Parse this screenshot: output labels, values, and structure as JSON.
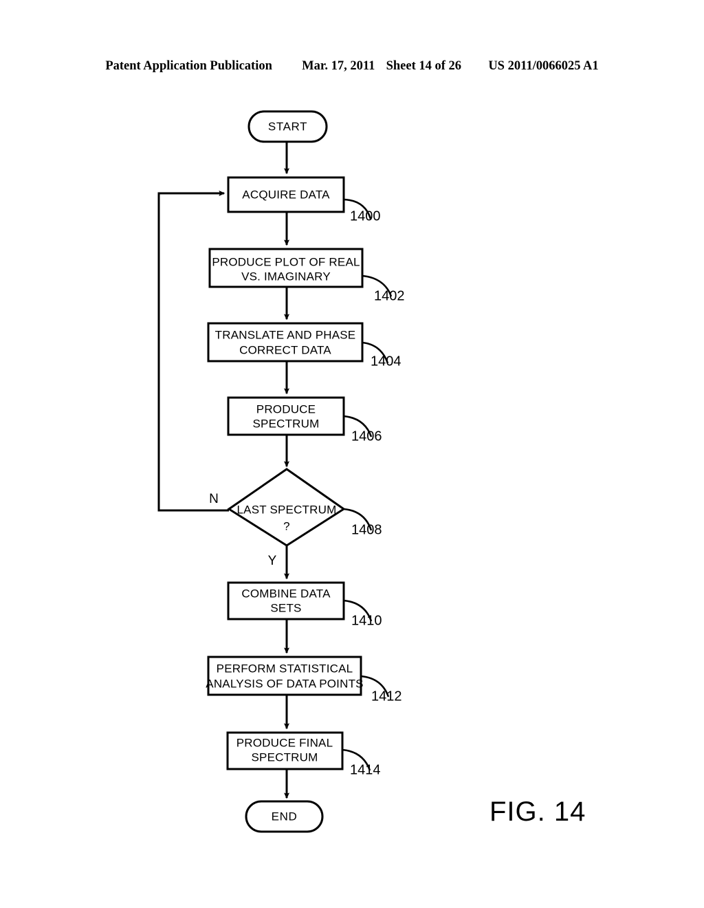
{
  "header": {
    "publication": "Patent Application Publication",
    "date": "Mar. 17, 2011",
    "sheet": "Sheet 14 of 26",
    "patent_number": "US 2011/0066025 A1"
  },
  "figure": {
    "label": "FIG. 14"
  },
  "flowchart": {
    "start_label": "START",
    "end_label": "END",
    "branch_no": "N",
    "branch_yes": "Y",
    "nodes": [
      {
        "id": "acquire-data",
        "shape": "process",
        "ref": "1400",
        "lines": [
          "ACQUIRE DATA"
        ]
      },
      {
        "id": "produce-plot",
        "shape": "process",
        "ref": "1402",
        "lines": [
          "PRODUCE PLOT OF REAL",
          "VS. IMAGINARY"
        ]
      },
      {
        "id": "translate-phase-correct",
        "shape": "process",
        "ref": "1404",
        "lines": [
          "TRANSLATE AND PHASE",
          "CORRECT DATA"
        ]
      },
      {
        "id": "produce-spectrum",
        "shape": "process",
        "ref": "1406",
        "lines": [
          "PRODUCE",
          "SPECTRUM"
        ]
      },
      {
        "id": "last-spectrum-decision",
        "shape": "decision",
        "ref": "1408",
        "lines": [
          "LAST SPECTRUM",
          "?"
        ]
      },
      {
        "id": "combine-data-sets",
        "shape": "process",
        "ref": "1410",
        "lines": [
          "COMBINE DATA",
          "SETS"
        ]
      },
      {
        "id": "statistical-analysis",
        "shape": "process",
        "ref": "1412",
        "lines": [
          "PERFORM STATISTICAL",
          "ANALYSIS OF DATA POINTS"
        ]
      },
      {
        "id": "produce-final-spectrum",
        "shape": "process",
        "ref": "1414",
        "lines": [
          "PRODUCE FINAL",
          "SPECTRUM"
        ]
      }
    ]
  },
  "colors": {
    "ink": "#000000",
    "paper": "#ffffff"
  }
}
